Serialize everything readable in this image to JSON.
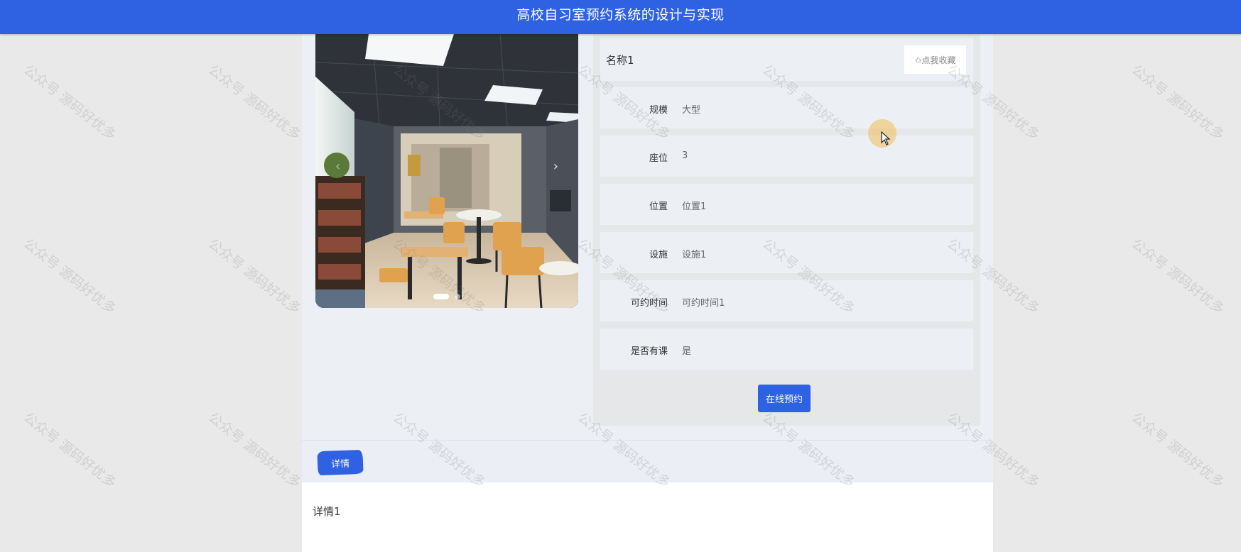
{
  "header": {
    "title": "高校自习室预约系统的设计与实现"
  },
  "carousel": {
    "slide_count": 2,
    "active_index": 0,
    "prev_icon": "‹",
    "next_icon": "›"
  },
  "room": {
    "name": "名称1",
    "favorite_label": "✩点我收藏",
    "fields": [
      {
        "label": "规模",
        "value": "大型"
      },
      {
        "label": "座位",
        "value": "3"
      },
      {
        "label": "位置",
        "value": "位置1"
      },
      {
        "label": "设施",
        "value": "设施1"
      },
      {
        "label": "可约时间",
        "value": "可约时间1"
      },
      {
        "label": "是否有课",
        "value": "是"
      }
    ],
    "reserve_label": "在线预约"
  },
  "detail": {
    "tab_label": "详情",
    "content": "详情1"
  },
  "watermark": {
    "text": "公众号 源码好优多"
  },
  "colors": {
    "primary": "#2f62e3",
    "page_bg": "#e9e9ea",
    "panel_bg": "#eceff4"
  }
}
